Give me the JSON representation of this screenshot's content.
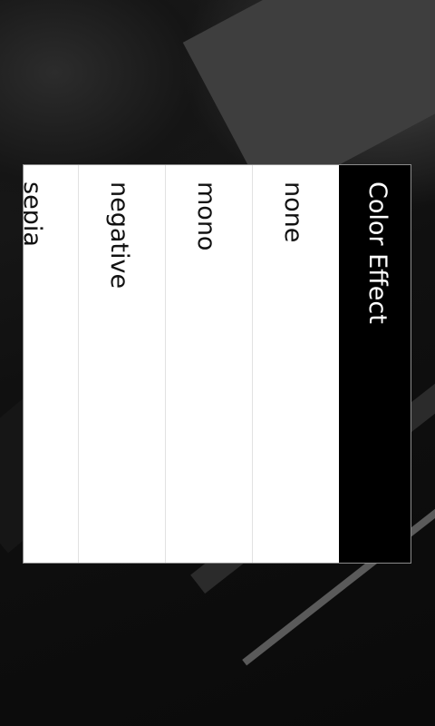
{
  "dialog": {
    "title": "Color Effect",
    "options": [
      "none",
      "mono",
      "negative",
      "sepia"
    ]
  },
  "colors": {
    "title_bar": "#000000",
    "list_background": "#ffffff",
    "dialog_border": "#8c8c8c"
  }
}
